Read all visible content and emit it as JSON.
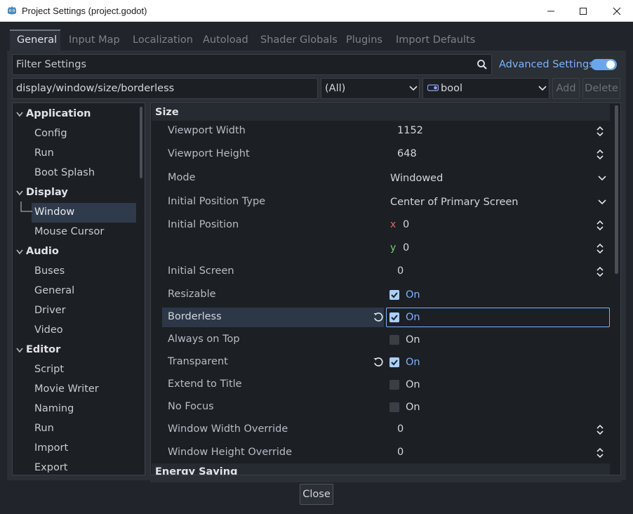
{
  "window": {
    "title": "Project Settings (project.godot)",
    "minimize_icon": "minimize-icon",
    "maximize_icon": "maximize-icon",
    "close_icon": "close-icon"
  },
  "tabs": [
    {
      "label": "General",
      "active": true
    },
    {
      "label": "Input Map",
      "active": false
    },
    {
      "label": "Localization",
      "active": false
    },
    {
      "label": "Autoload",
      "active": false
    },
    {
      "label": "Shader Globals",
      "active": false
    },
    {
      "label": "Plugins",
      "active": false
    },
    {
      "label": "Import Defaults",
      "active": false
    }
  ],
  "search": {
    "placeholder": "Filter Settings",
    "advanced_label": "Advanced Settings",
    "advanced_enabled": true
  },
  "add_row": {
    "path": "display/window/size/borderless",
    "category": "(All)",
    "type": "bool",
    "add_label": "Add",
    "delete_label": "Delete"
  },
  "tree": {
    "categories": [
      {
        "label": "Application",
        "items": [
          "Config",
          "Run",
          "Boot Splash"
        ]
      },
      {
        "label": "Display",
        "items": [
          "Window",
          "Mouse Cursor"
        ]
      },
      {
        "label": "Audio",
        "items": [
          "Buses",
          "General",
          "Driver",
          "Video"
        ]
      },
      {
        "label": "Editor",
        "items": [
          "Script",
          "Movie Writer",
          "Naming",
          "Run",
          "Import",
          "Export"
        ]
      }
    ],
    "selected": "Window"
  },
  "inspector": {
    "section": "Size",
    "next_section": "Energy Saving",
    "props": {
      "viewport_width": {
        "label": "Viewport Width",
        "value": "1152"
      },
      "viewport_height": {
        "label": "Viewport Height",
        "value": "648"
      },
      "mode": {
        "label": "Mode",
        "value": "Windowed"
      },
      "initial_position_type": {
        "label": "Initial Position Type",
        "value": "Center of Primary Screen"
      },
      "initial_position": {
        "label": "Initial Position",
        "x_axis": "x",
        "x": "0",
        "y_axis": "y",
        "y": "0"
      },
      "initial_screen": {
        "label": "Initial Screen",
        "value": "0"
      },
      "resizable": {
        "label": "Resizable",
        "checked": true,
        "text": "On"
      },
      "borderless": {
        "label": "Borderless",
        "checked": true,
        "text": "On"
      },
      "always_on_top": {
        "label": "Always on Top",
        "checked": false,
        "text": "On"
      },
      "transparent": {
        "label": "Transparent",
        "checked": true,
        "text": "On"
      },
      "extend_to_title": {
        "label": "Extend to Title",
        "checked": false,
        "text": "On"
      },
      "no_focus": {
        "label": "No Focus",
        "checked": false,
        "text": "On"
      },
      "window_width_override": {
        "label": "Window Width Override",
        "value": "0"
      },
      "window_height_override": {
        "label": "Window Height Override",
        "value": "0"
      }
    }
  },
  "footer": {
    "close_label": "Close"
  },
  "colors": {
    "accent": "#78b4ff",
    "panel": "#1c1f24",
    "background": "#21252b",
    "selection": "#2f3b4b"
  }
}
